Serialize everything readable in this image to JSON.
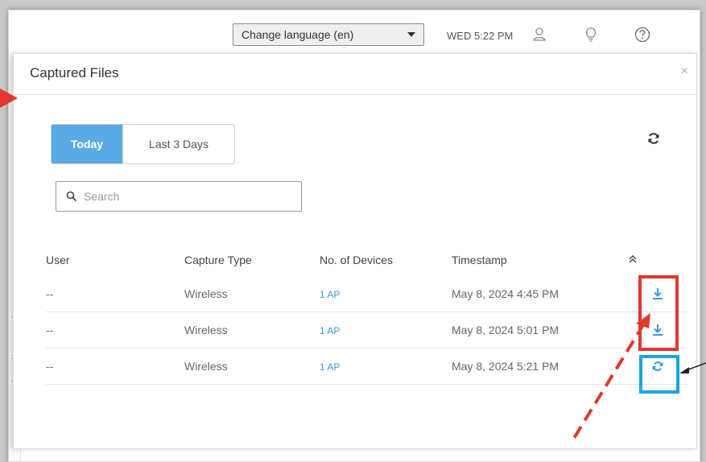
{
  "topbar": {
    "language_label": "Change language (en)",
    "clock": "WED 5:22 PM",
    "icons": [
      "user-icon",
      "lightbulb-icon",
      "help-icon"
    ]
  },
  "panel": {
    "title": "Captured Files",
    "close_label": "×"
  },
  "filters": {
    "tabs": [
      {
        "label": "Today",
        "active": true
      },
      {
        "label": "Last 3 Days",
        "active": false
      }
    ]
  },
  "search": {
    "placeholder": "Search"
  },
  "table": {
    "columns": [
      "User",
      "Capture Type",
      "No. of Devices",
      "Timestamp"
    ],
    "rows": [
      {
        "user": "--",
        "capture_type": "Wireless",
        "devices": "1 AP",
        "timestamp": "May 8, 2024 4:45 PM",
        "action": "download-icon"
      },
      {
        "user": "--",
        "capture_type": "Wireless",
        "devices": "1 AP",
        "timestamp": "May 8, 2024 5:01 PM",
        "action": "download-icon"
      },
      {
        "user": "--",
        "capture_type": "Wireless",
        "devices": "1 AP",
        "timestamp": "May 8, 2024 5:21 PM",
        "action": "refresh-icon"
      }
    ]
  },
  "colors": {
    "accent": "#5aabe5",
    "link": "#3a9ad9",
    "highlight_red": "#e2362f",
    "highlight_blue": "#1aa6e0"
  }
}
